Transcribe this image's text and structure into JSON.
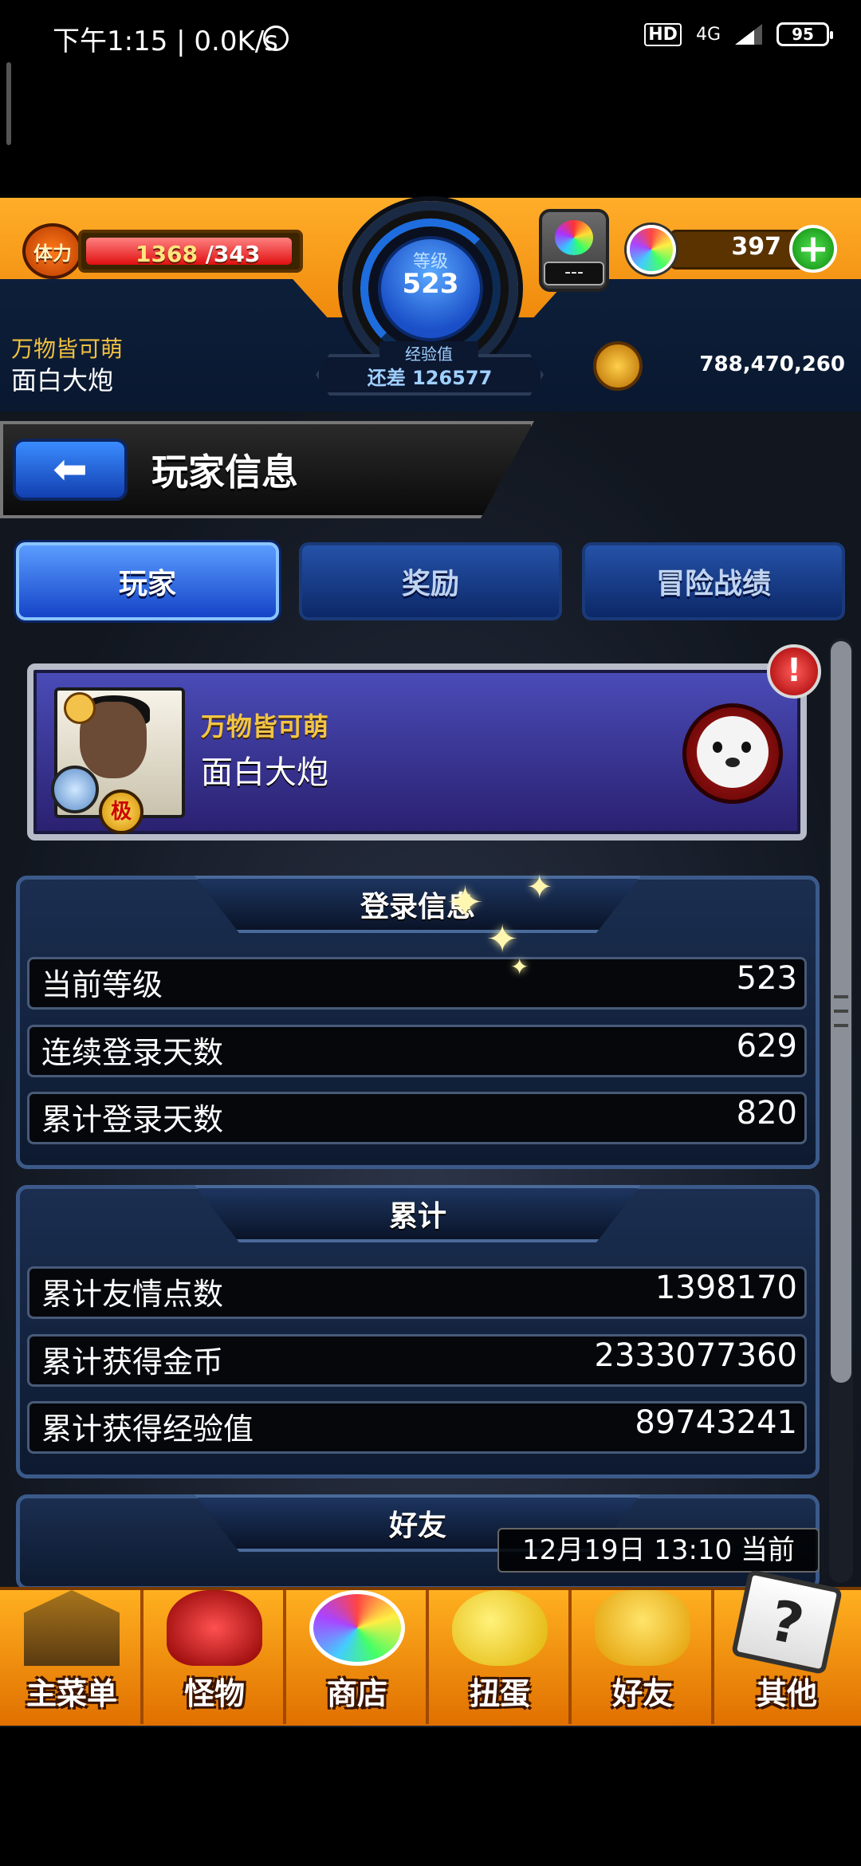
{
  "status_bar": {
    "time": "下午1:15 | 0.0K/s",
    "alarm_icon": "alarm-clock-icon",
    "hd": "HD",
    "network": "4G",
    "battery": "95"
  },
  "hud": {
    "stamina_label": "体力",
    "stamina_current": "1368",
    "stamina_max": "/343",
    "level_label": "等级",
    "level": "523",
    "exp_label": "经验值",
    "exp_remaining": "还差 126577",
    "gem_box_text": "---",
    "orb_count": "397",
    "coins": "788,470,260",
    "player_title": "万物皆可萌",
    "player_name": "面白大炮"
  },
  "page": {
    "title": "玩家信息",
    "back_icon": "back-arrow-icon"
  },
  "tabs": [
    {
      "label": "玩家",
      "active": true
    },
    {
      "label": "奖励",
      "active": false
    },
    {
      "label": "冒险战绩",
      "active": false
    }
  ],
  "card": {
    "title": "万物皆可萌",
    "name": "面白大炮",
    "badge_rank": "极",
    "alert": "!"
  },
  "sections": {
    "login": {
      "header": "登录信息",
      "rows": [
        {
          "label": "当前等级",
          "value": "523"
        },
        {
          "label": "连续登录天数",
          "value": "629"
        },
        {
          "label": "累计登录天数",
          "value": "820"
        }
      ]
    },
    "total": {
      "header": "累计",
      "rows": [
        {
          "label": "累计友情点数",
          "value": "1398170"
        },
        {
          "label": "累计获得金币",
          "value": "2333077360"
        },
        {
          "label": "累计获得经验值",
          "value": "89743241"
        }
      ]
    },
    "friends": {
      "header": "好友"
    }
  },
  "timestamp": "12月19日 13:10 当前",
  "bottom_nav": [
    {
      "label": "主菜单",
      "icon": "castle-gate-icon"
    },
    {
      "label": "怪物",
      "icon": "monster-icon"
    },
    {
      "label": "商店",
      "icon": "rainbow-orb-icon"
    },
    {
      "label": "扭蛋",
      "icon": "egg-icon"
    },
    {
      "label": "好友",
      "icon": "friends-icon"
    },
    {
      "label": "其他",
      "icon": "question-icon"
    }
  ],
  "colors": {
    "accent_orange": "#f08a0c",
    "tab_active": "#1544c8",
    "title_gold": "#f2c544"
  }
}
